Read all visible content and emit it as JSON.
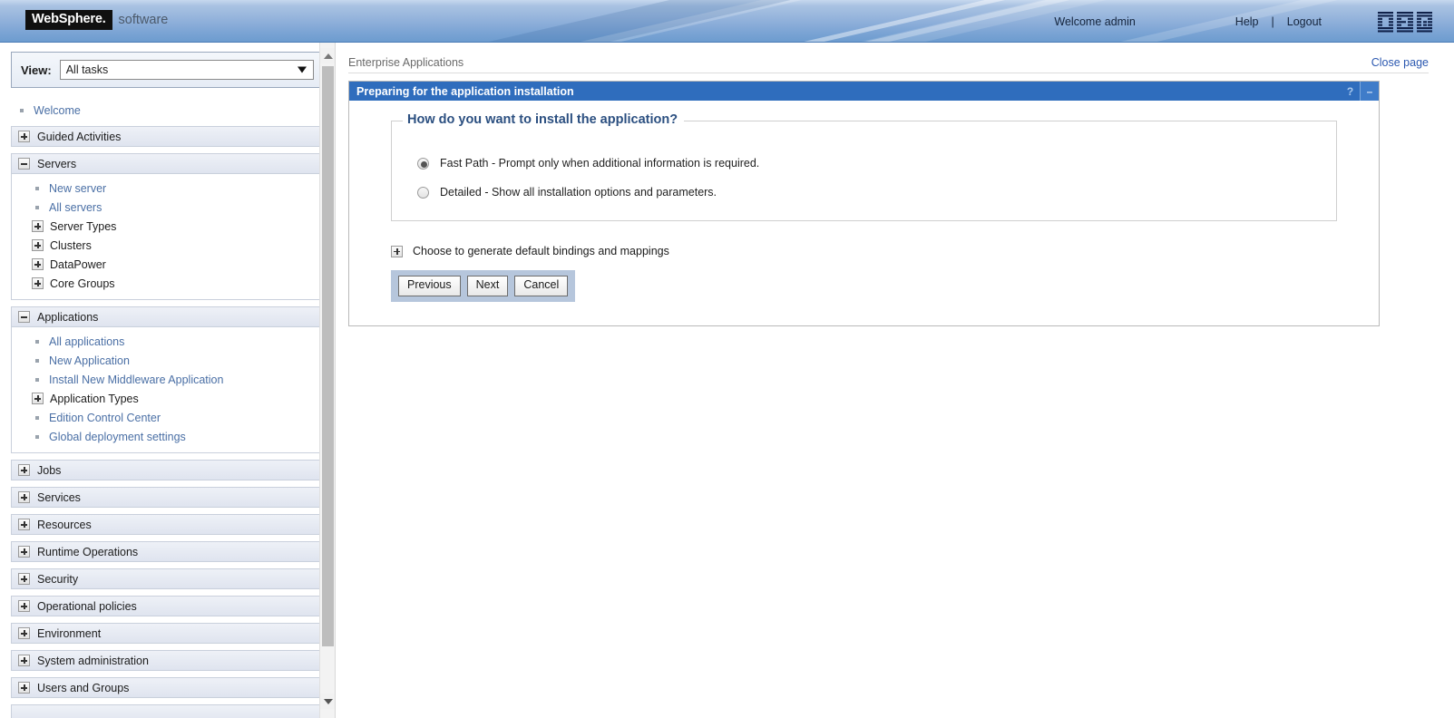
{
  "banner": {
    "product_logo": "WebSphere.",
    "product_suffix": "software",
    "welcome": "Welcome admin",
    "help": "Help",
    "separator": "|",
    "logout": "Logout",
    "brand_logo": "IBM."
  },
  "sidebar": {
    "view_label": "View:",
    "view_value": "All tasks",
    "welcome_link": "Welcome",
    "sections": [
      {
        "label": "Guided Activities",
        "expanded": false
      },
      {
        "label": "Servers",
        "expanded": true,
        "links": [
          "New server",
          "All servers"
        ],
        "groups": [
          "Server Types",
          "Clusters",
          "DataPower",
          "Core Groups"
        ]
      },
      {
        "label": "Applications",
        "expanded": true,
        "links_top": [
          "All applications",
          "New Application",
          "Install New Middleware Application"
        ],
        "group": "Application Types",
        "links_bottom": [
          "Edition Control Center",
          "Global deployment settings"
        ]
      },
      {
        "label": "Jobs",
        "expanded": false
      },
      {
        "label": "Services",
        "expanded": false
      },
      {
        "label": "Resources",
        "expanded": false
      },
      {
        "label": "Runtime Operations",
        "expanded": false
      },
      {
        "label": "Security",
        "expanded": false
      },
      {
        "label": "Operational policies",
        "expanded": false
      },
      {
        "label": "Environment",
        "expanded": false
      },
      {
        "label": "System administration",
        "expanded": false
      },
      {
        "label": "Users and Groups",
        "expanded": false
      }
    ]
  },
  "main": {
    "breadcrumb": "Enterprise Applications",
    "close_page": "Close page",
    "portlet_title": "Preparing for the application installation",
    "help_icon": "?",
    "minimize_icon": "–",
    "fieldset_legend": "How do you want to install the application?",
    "options": [
      {
        "label": "Fast Path - Prompt only when additional information is required.",
        "selected": true
      },
      {
        "label": "Detailed - Show all installation options and parameters.",
        "selected": false
      }
    ],
    "expand_section": "Choose to generate default bindings and mappings",
    "buttons": [
      "Previous",
      "Next",
      "Cancel"
    ]
  },
  "colors": {
    "banner_blue": "#8fb0da",
    "portlet_title_blue": "#2f6dbd",
    "link_blue": "#4a6fa5",
    "legend_blue": "#2b4f80",
    "button_bar": "#b6c6dc"
  }
}
